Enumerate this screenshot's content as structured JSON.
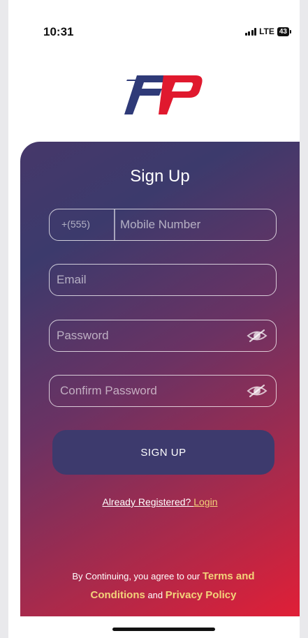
{
  "status_bar": {
    "time": "10:31",
    "network": "LTE",
    "battery": "43"
  },
  "logo": {
    "name": "fp-logo",
    "text": "FP",
    "colors": {
      "f": "#2f3a78",
      "p": "#e0192e"
    }
  },
  "signup": {
    "title": "Sign Up",
    "phone_prefix": "+(555)",
    "mobile_placeholder": "Mobile Number",
    "email_placeholder": "Email",
    "password_placeholder": "Password",
    "confirm_password_placeholder": "Confirm Password",
    "submit_label": "SIGN UP",
    "already_text": "Already Registered? ",
    "login_link": "Login"
  },
  "terms": {
    "prefix": "By Continuing, you agree to our ",
    "terms_link": "Terms and Conditions",
    "and": " and ",
    "privacy_link": "Privacy Policy"
  },
  "colors": {
    "gradient_start": "#3c3a6c",
    "gradient_end": "#e01f37",
    "button": "#3d3a6d",
    "link_accent": "#f3d37a"
  }
}
